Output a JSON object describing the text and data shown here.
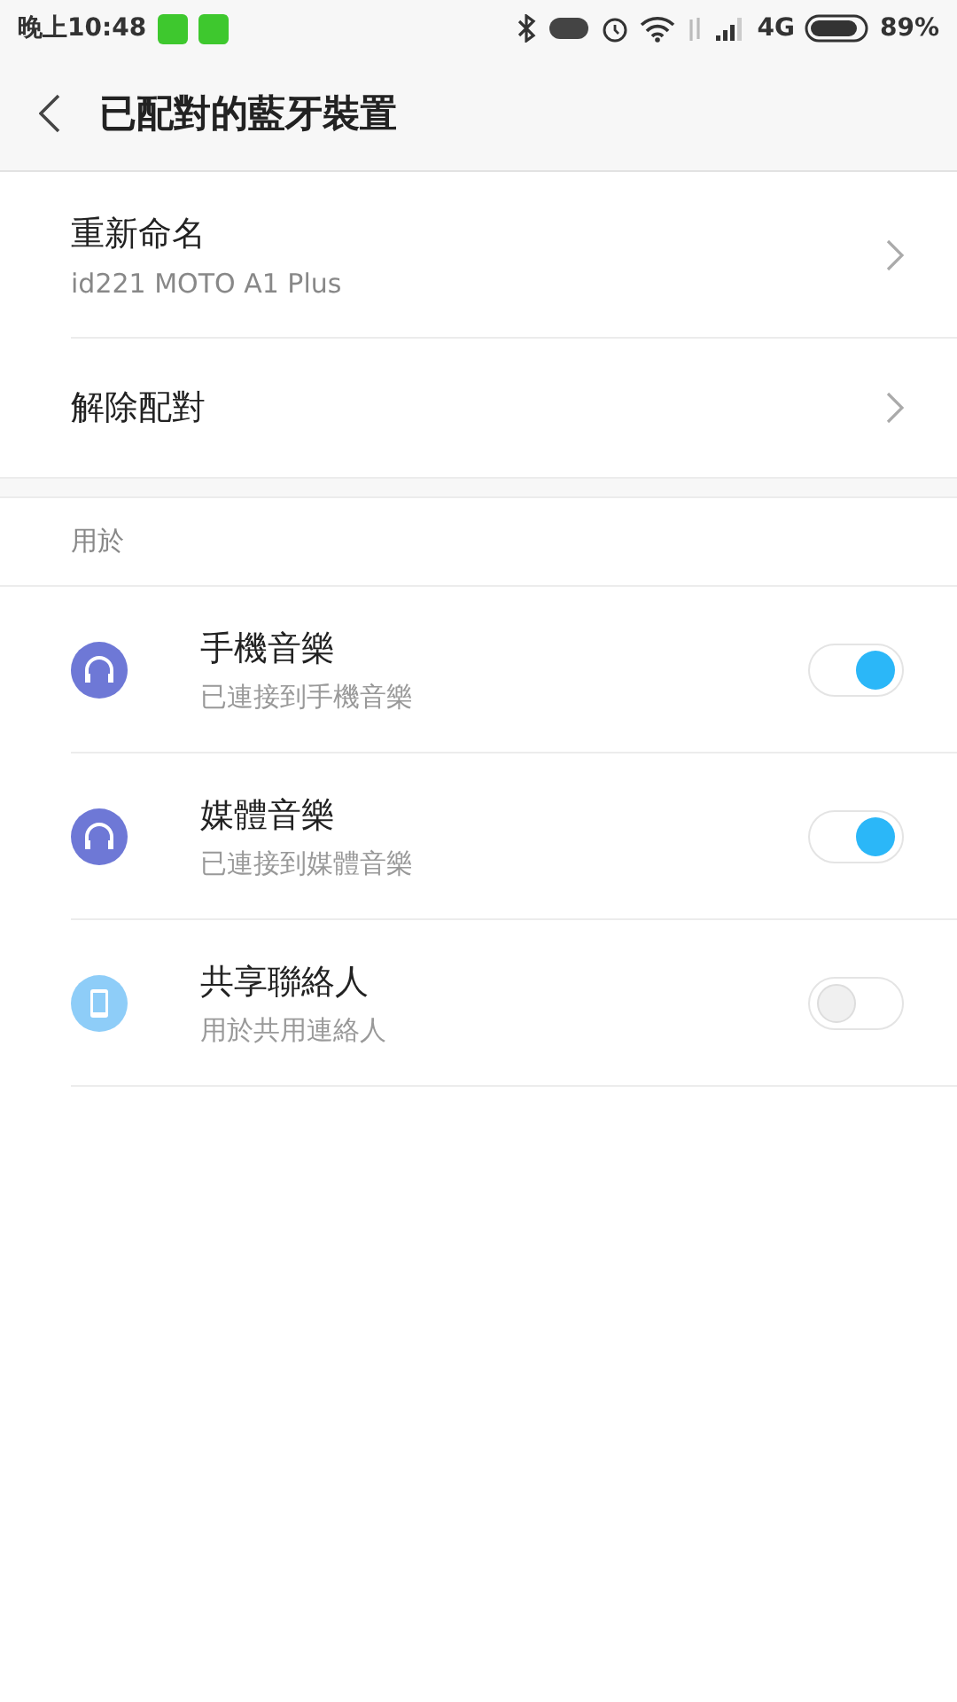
{
  "status_bar": {
    "time": "晚上10:48",
    "network": "4G",
    "battery_percent": "89%"
  },
  "header": {
    "title": "已配對的藍牙裝置"
  },
  "actions": [
    {
      "label": "重新命名",
      "subtitle": "id221 MOTO A1 Plus"
    },
    {
      "label": "解除配對"
    }
  ],
  "section": {
    "title": "用於"
  },
  "profiles": [
    {
      "kind": "headphones",
      "name": "手機音樂",
      "description": "已連接到手機音樂",
      "on": true
    },
    {
      "kind": "headphones",
      "name": "媒體音樂",
      "description": "已連接到媒體音樂",
      "on": true
    },
    {
      "kind": "phone",
      "name": "共享聯絡人",
      "description": "用於共用連絡人",
      "on": false
    }
  ]
}
